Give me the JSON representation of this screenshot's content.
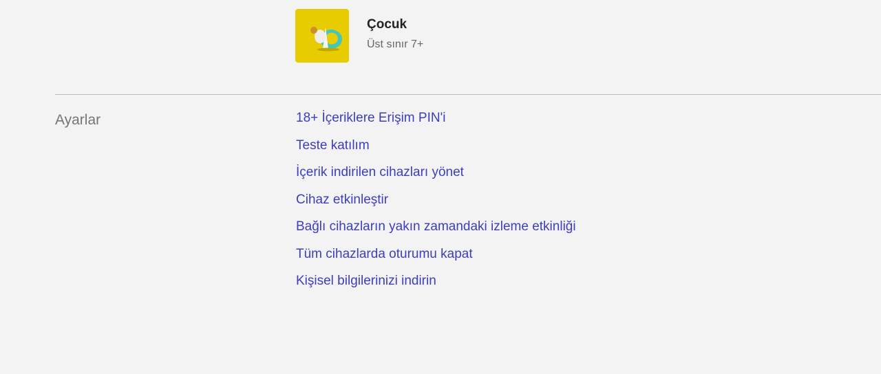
{
  "profile": {
    "name": "Çocuk",
    "limit": "Üst sınır 7+",
    "avatar_icon": "kids-profile-icon",
    "avatar_color": "#e6cc00"
  },
  "settings": {
    "label": "Ayarlar",
    "link_color": "#3d3dbf",
    "items": [
      {
        "label": "18+ İçeriklere Erişim PIN'i"
      },
      {
        "label": "Teste katılım"
      },
      {
        "label": "İçerik indirilen cihazları yönet"
      },
      {
        "label": "Cihaz etkinleştir"
      },
      {
        "label": "Bağlı cihazların yakın zamandaki izleme etkinliği"
      },
      {
        "label": "Tüm cihazlarda oturumu kapat"
      },
      {
        "label": "Kişisel bilgilerinizi indirin"
      }
    ]
  }
}
